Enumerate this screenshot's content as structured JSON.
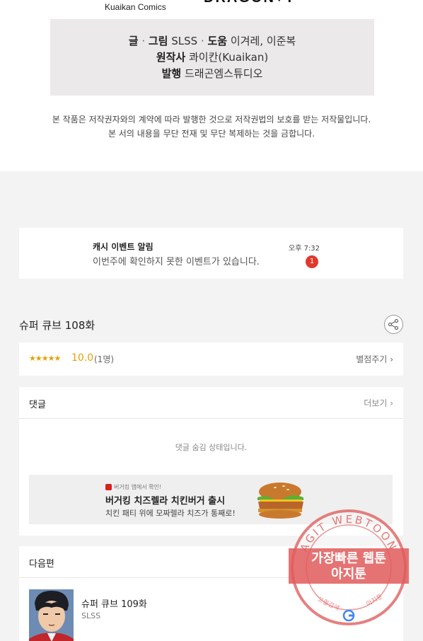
{
  "credits": {
    "publisher": "Kuaikan Comics",
    "brand_logo": "DRAGON+Y",
    "writer_label": "글",
    "art_label": "그림",
    "creator": "SLSS",
    "assist_label": "도움",
    "assistants": "이겨레, 이준복",
    "original_label": "원작사",
    "original_value": "콰이칸(Kuaikan)",
    "publisher_label": "발행",
    "publisher_value": "드래곤엠스튜디오",
    "copyright_line1": "본 작품은 저작권자와의 계약에 따라 발행한 것으로 저작권법의 보호를 받는 저작물입니다.",
    "copyright_line2": "본 서의 내용을 무단 전재 및 무단 복제하는 것을 금합니다."
  },
  "notice": {
    "title": "캐시 이벤트 알림",
    "message": "이번주에 확인하지 못한 이벤트가 있습니다.",
    "time": "오후 7:32",
    "badge": "1"
  },
  "episode": {
    "title": "슈퍼 큐브 108화",
    "share_icon": "share-icon"
  },
  "rating": {
    "stars": "★★★★★",
    "score": "10.0",
    "count": "(1명)",
    "rate_label": "별점주기"
  },
  "comments": {
    "title": "댓글",
    "more_label": "더보기",
    "hidden_message": "댓글 숨김 상태입니다."
  },
  "ad": {
    "tag": "버거킹 앱에서 확인!",
    "title": "버거킹 치즈렐라 치킨버거 출시",
    "description": "치킨 패티 위에 모짜렐라 치즈가 통째로!"
  },
  "next_episode": {
    "section_title": "다음편",
    "title": "슈퍼 큐브 109화",
    "author": "SLSS"
  },
  "stamp": {
    "ring_text": "AGIT WEBTOON",
    "line1": "가장빠른 웹툰",
    "line2": "아지툰",
    "bottom_left": "고퀄검색",
    "bottom_right": "아지툰"
  },
  "colors": {
    "accent_star": "#e5a000",
    "badge_red": "#e2372b",
    "stamp_red": "#e05a5a"
  }
}
